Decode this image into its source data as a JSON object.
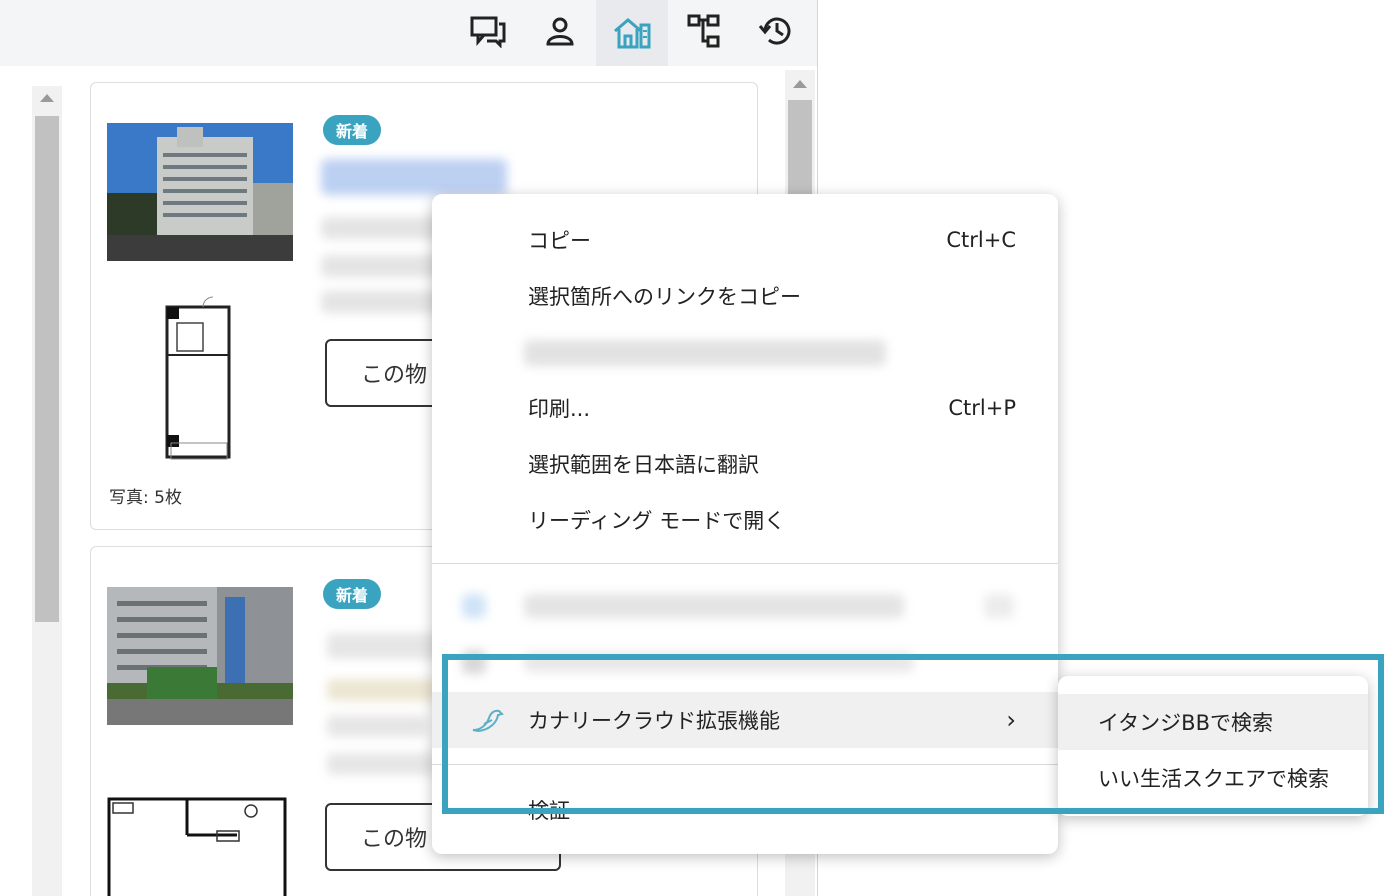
{
  "colors": {
    "accent": "#3aa3bf",
    "highlight_box": "#3aa3bf"
  },
  "toolbar": {
    "icons": [
      "chat-icon",
      "person-icon",
      "house-icon",
      "diagram-icon",
      "history-icon"
    ],
    "active_icon": "house-icon"
  },
  "listings": [
    {
      "badge": "新着",
      "button": "この物",
      "photo_count": "写真: 5枚"
    },
    {
      "badge": "新着",
      "button": "この物"
    }
  ],
  "menu": {
    "copy": {
      "label": "コピー",
      "shortcut": "Ctrl+C"
    },
    "copy_link": {
      "label": "選択箇所へのリンクをコピー"
    },
    "print": {
      "label": "印刷...",
      "shortcut": "Ctrl+P"
    },
    "translate": {
      "label": "選択範囲を日本語に翻訳"
    },
    "reading_mode": {
      "label": "リーディング モードで開く"
    },
    "extension": {
      "label": "カナリークラウド拡張機能",
      "arrow": "›"
    },
    "inspect": {
      "label": "検証"
    }
  },
  "submenu": {
    "items": [
      "イタンジBBで検索",
      "いい生活スクエアで検索"
    ]
  }
}
